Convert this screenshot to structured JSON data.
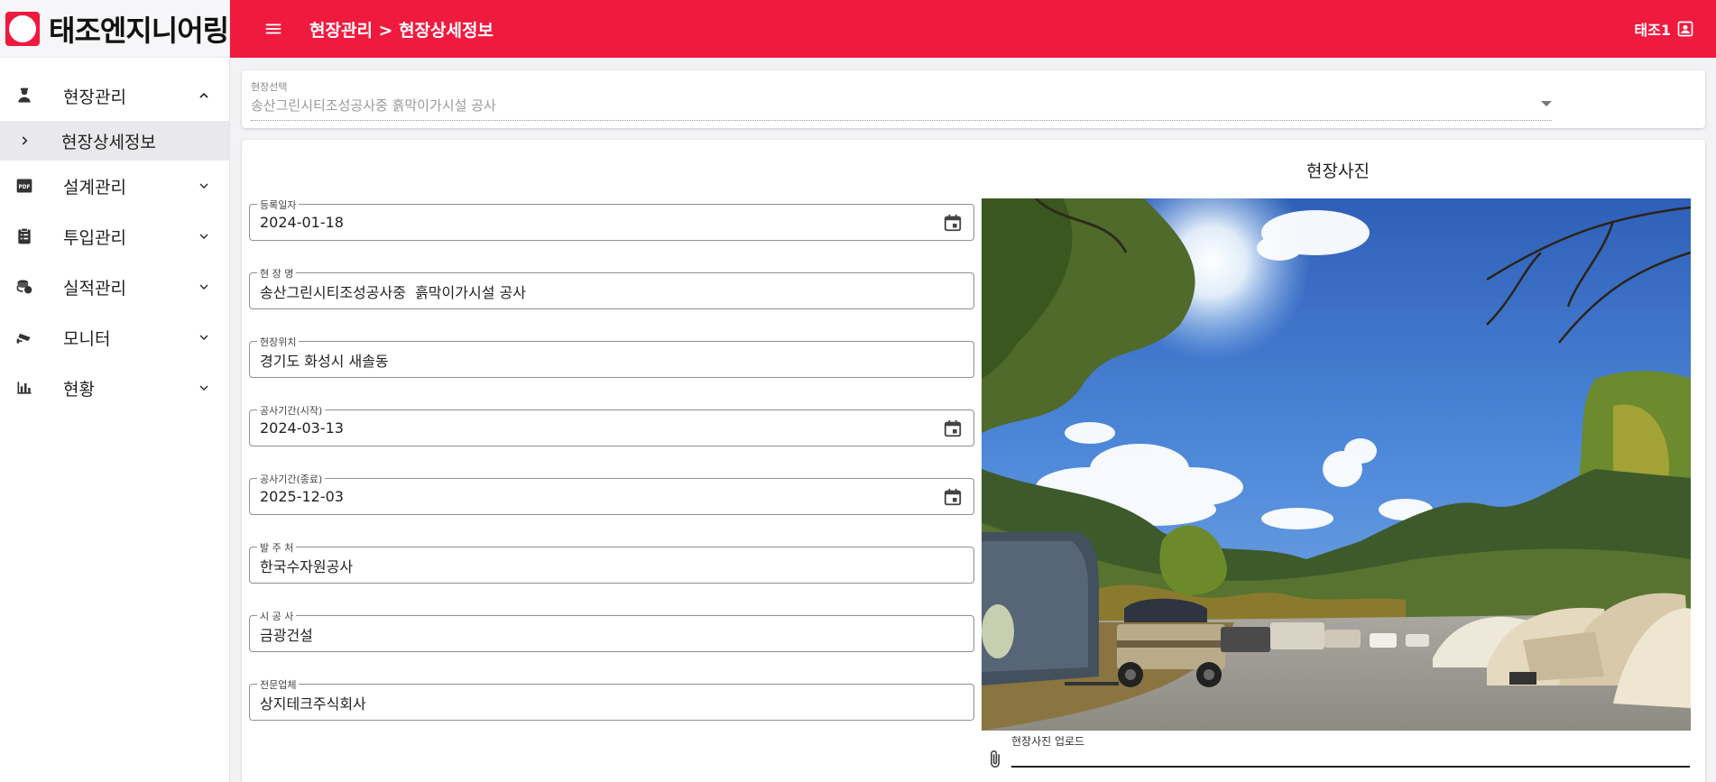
{
  "app": {
    "logo_text": "태조엔지니어링",
    "accent": "#ef1a3e"
  },
  "header": {
    "breadcrumb": "현장관리 > 현장상세정보",
    "user_name": "태조1",
    "menu_icon": "hamburger-icon",
    "user_icon": "account-box-icon"
  },
  "sidebar": {
    "items": [
      {
        "label": "현장관리",
        "icon": "worker-icon",
        "expanded": true
      },
      {
        "label": "현장상세정보",
        "icon": "chevron-right-icon",
        "selected": true
      },
      {
        "label": "설계관리",
        "icon": "pdf-icon"
      },
      {
        "label": "투입관리",
        "icon": "clipboard-icon"
      },
      {
        "label": "실적관리",
        "icon": "coins-icon"
      },
      {
        "label": "모니터",
        "icon": "cctv-icon"
      },
      {
        "label": "현황",
        "icon": "bar-chart-icon"
      }
    ]
  },
  "site_select": {
    "label": "현장선택",
    "value": "송산그린시티조성공사중 흙막이가시설 공사"
  },
  "form": {
    "fields": [
      {
        "label": "등록일자",
        "value": "2024-01-18",
        "has_calendar": true
      },
      {
        "label": "현 장 명",
        "value": "송산그린시티조성공사중  흙막이가시설 공사"
      },
      {
        "label": "현장위치",
        "value": "경기도 화성시 새솔동"
      },
      {
        "label": "공사기간(시작)",
        "value": "2024-03-13",
        "has_calendar": true
      },
      {
        "label": "공사기간(종료)",
        "value": "2025-12-03",
        "has_calendar": true
      },
      {
        "label": "발 주 처",
        "value": "한국수자원공사"
      },
      {
        "label": "시 공 사",
        "value": "금광건설"
      },
      {
        "label": "전문업체",
        "value": "상지테크주식회사"
      }
    ]
  },
  "photo": {
    "title": "현장사진",
    "upload_label": "현장사진 업로드"
  }
}
